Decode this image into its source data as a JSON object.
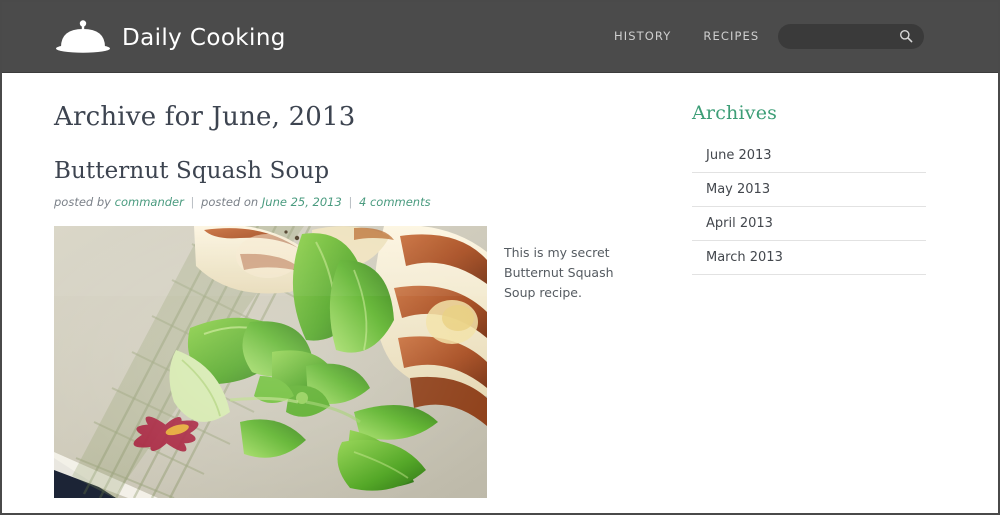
{
  "header": {
    "brand": {
      "name": "Daily Cooking",
      "icon": "cloche-icon"
    },
    "nav": [
      {
        "label": "HISTORY"
      },
      {
        "label": "RECIPES"
      }
    ],
    "search": {
      "value": "",
      "placeholder": "",
      "icon": "search-icon"
    },
    "background_color": "#4b4b4b"
  },
  "main": {
    "archive_title": "Archive for June, 2013",
    "post": {
      "title": "Butternut Squash Soup",
      "meta": {
        "posted_by_label": "posted by",
        "author": "commander",
        "posted_on_label": "posted on",
        "date": "June 25, 2013",
        "comments": "4 comments",
        "separator": "|"
      },
      "body": "This is my secret Butternut Squash Soup recipe.",
      "image_alt": "Plate of greens with bacon-wrapped food"
    }
  },
  "sidebar": {
    "title": "Archives",
    "items": [
      {
        "label": "June 2013"
      },
      {
        "label": "May 2013"
      },
      {
        "label": "April 2013"
      },
      {
        "label": "March 2013"
      }
    ]
  },
  "colors": {
    "header_bg": "#4b4b4b",
    "accent_green": "#3d9e77",
    "link_green": "#4a9b7f",
    "heading_dark": "#3d4450",
    "meta_gray": "#7b8189",
    "divider": "#e2e2e2"
  }
}
